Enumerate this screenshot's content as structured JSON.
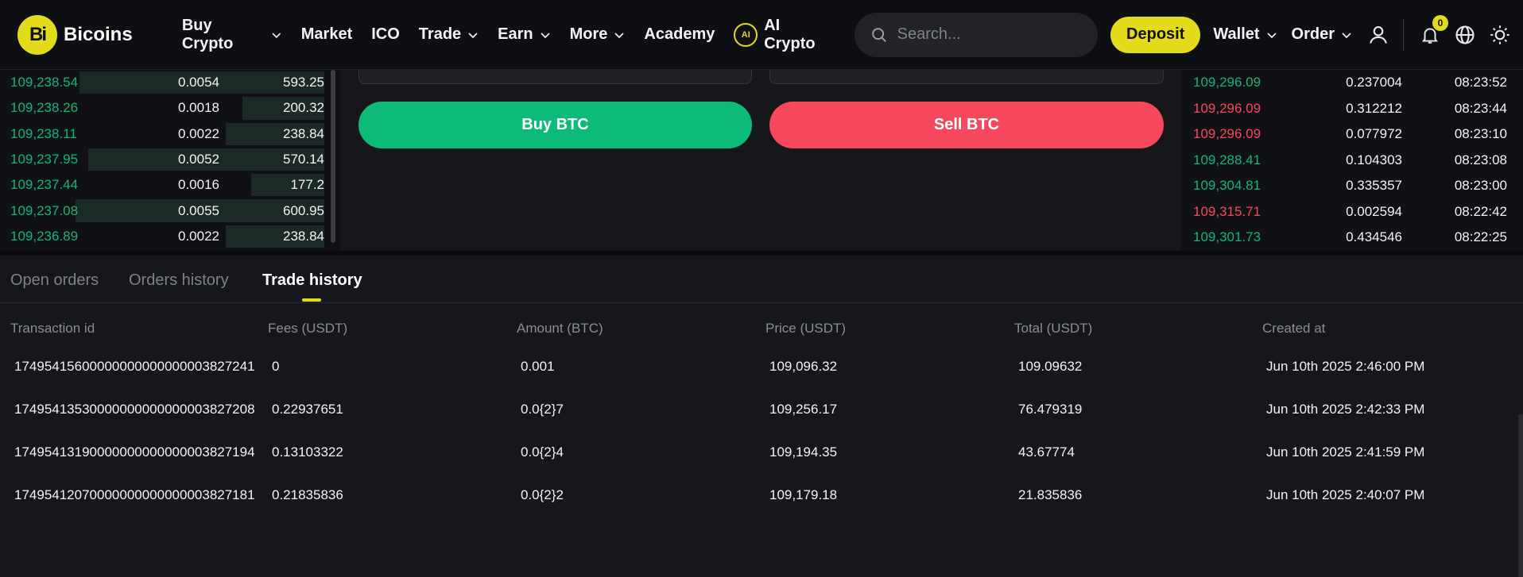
{
  "brand": {
    "logo_mark": "Bi",
    "name": "Bicoins",
    "accent": "#e4dc1a"
  },
  "nav": {
    "items": [
      {
        "label": "Buy Crypto",
        "dropdown": true
      },
      {
        "label": "Market",
        "dropdown": false
      },
      {
        "label": "ICO",
        "dropdown": false
      },
      {
        "label": "Trade",
        "dropdown": true
      },
      {
        "label": "Earn",
        "dropdown": true
      },
      {
        "label": "More",
        "dropdown": true
      },
      {
        "label": "Academy",
        "dropdown": false
      }
    ],
    "ai_badge": "AI",
    "ai_label": "AI Crypto",
    "search_placeholder": "Search...",
    "deposit_label": "Deposit",
    "wallet_label": "Wallet",
    "order_label": "Order",
    "notification_count": "0"
  },
  "orderbook": {
    "rows": [
      {
        "price": "109,238.54",
        "amount": "0.0054",
        "total": "593.25",
        "depth": 0.57
      },
      {
        "price": "109,238.26",
        "amount": "0.0018",
        "total": "200.32",
        "depth": 0.19
      },
      {
        "price": "109,238.11",
        "amount": "0.0022",
        "total": "238.84",
        "depth": 0.23
      },
      {
        "price": "109,237.95",
        "amount": "0.0052",
        "total": "570.14",
        "depth": 0.55
      },
      {
        "price": "109,237.44",
        "amount": "0.0016",
        "total": "177.2",
        "depth": 0.17
      },
      {
        "price": "109,237.08",
        "amount": "0.0055",
        "total": "600.95",
        "depth": 0.58
      },
      {
        "price": "109,236.89",
        "amount": "0.0022",
        "total": "238.84",
        "depth": 0.23
      }
    ]
  },
  "trade_panel": {
    "buy_label": "Buy BTC",
    "sell_label": "Sell BTC"
  },
  "recent_trades": {
    "rows": [
      {
        "price": "109,296.09",
        "amount": "0.237004",
        "time": "08:23:52",
        "side": "up"
      },
      {
        "price": "109,296.09",
        "amount": "0.312212",
        "time": "08:23:44",
        "side": "down"
      },
      {
        "price": "109,296.09",
        "amount": "0.077972",
        "time": "08:23:10",
        "side": "down"
      },
      {
        "price": "109,288.41",
        "amount": "0.104303",
        "time": "08:23:08",
        "side": "up"
      },
      {
        "price": "109,304.81",
        "amount": "0.335357",
        "time": "08:23:00",
        "side": "up"
      },
      {
        "price": "109,315.71",
        "amount": "0.002594",
        "time": "08:22:42",
        "side": "down"
      },
      {
        "price": "109,301.73",
        "amount": "0.434546",
        "time": "08:22:25",
        "side": "up"
      }
    ]
  },
  "history": {
    "tabs": [
      {
        "label": "Open orders",
        "active": false
      },
      {
        "label": "Orders history",
        "active": false
      },
      {
        "label": "Trade history",
        "active": true
      }
    ],
    "columns": [
      "Transaction id",
      "Fees (USDT)",
      "Amount (BTC)",
      "Price (USDT)",
      "Total (USDT)",
      "Created at"
    ],
    "rows": [
      [
        "17495415600000000000000003827241",
        "0",
        "0.001",
        "109,096.32",
        "109.09632",
        "Jun 10th 2025 2:46:00 PM"
      ],
      [
        "17495413530000000000000003827208",
        "0.22937651",
        "0.0{2}7",
        "109,256.17",
        "76.479319",
        "Jun 10th 2025 2:42:33 PM"
      ],
      [
        "17495413190000000000000003827194",
        "0.13103322",
        "0.0{2}4",
        "109,194.35",
        "43.67774",
        "Jun 10th 2025 2:41:59 PM"
      ],
      [
        "17495412070000000000000003827181",
        "0.21835836",
        "0.0{2}2",
        "109,179.18",
        "21.835836",
        "Jun 10th 2025 2:40:07 PM"
      ]
    ]
  },
  "colors": {
    "buy": "#0dbb78",
    "sell": "#f5485d",
    "price_up": "#12b57a",
    "background": "#16171b"
  }
}
